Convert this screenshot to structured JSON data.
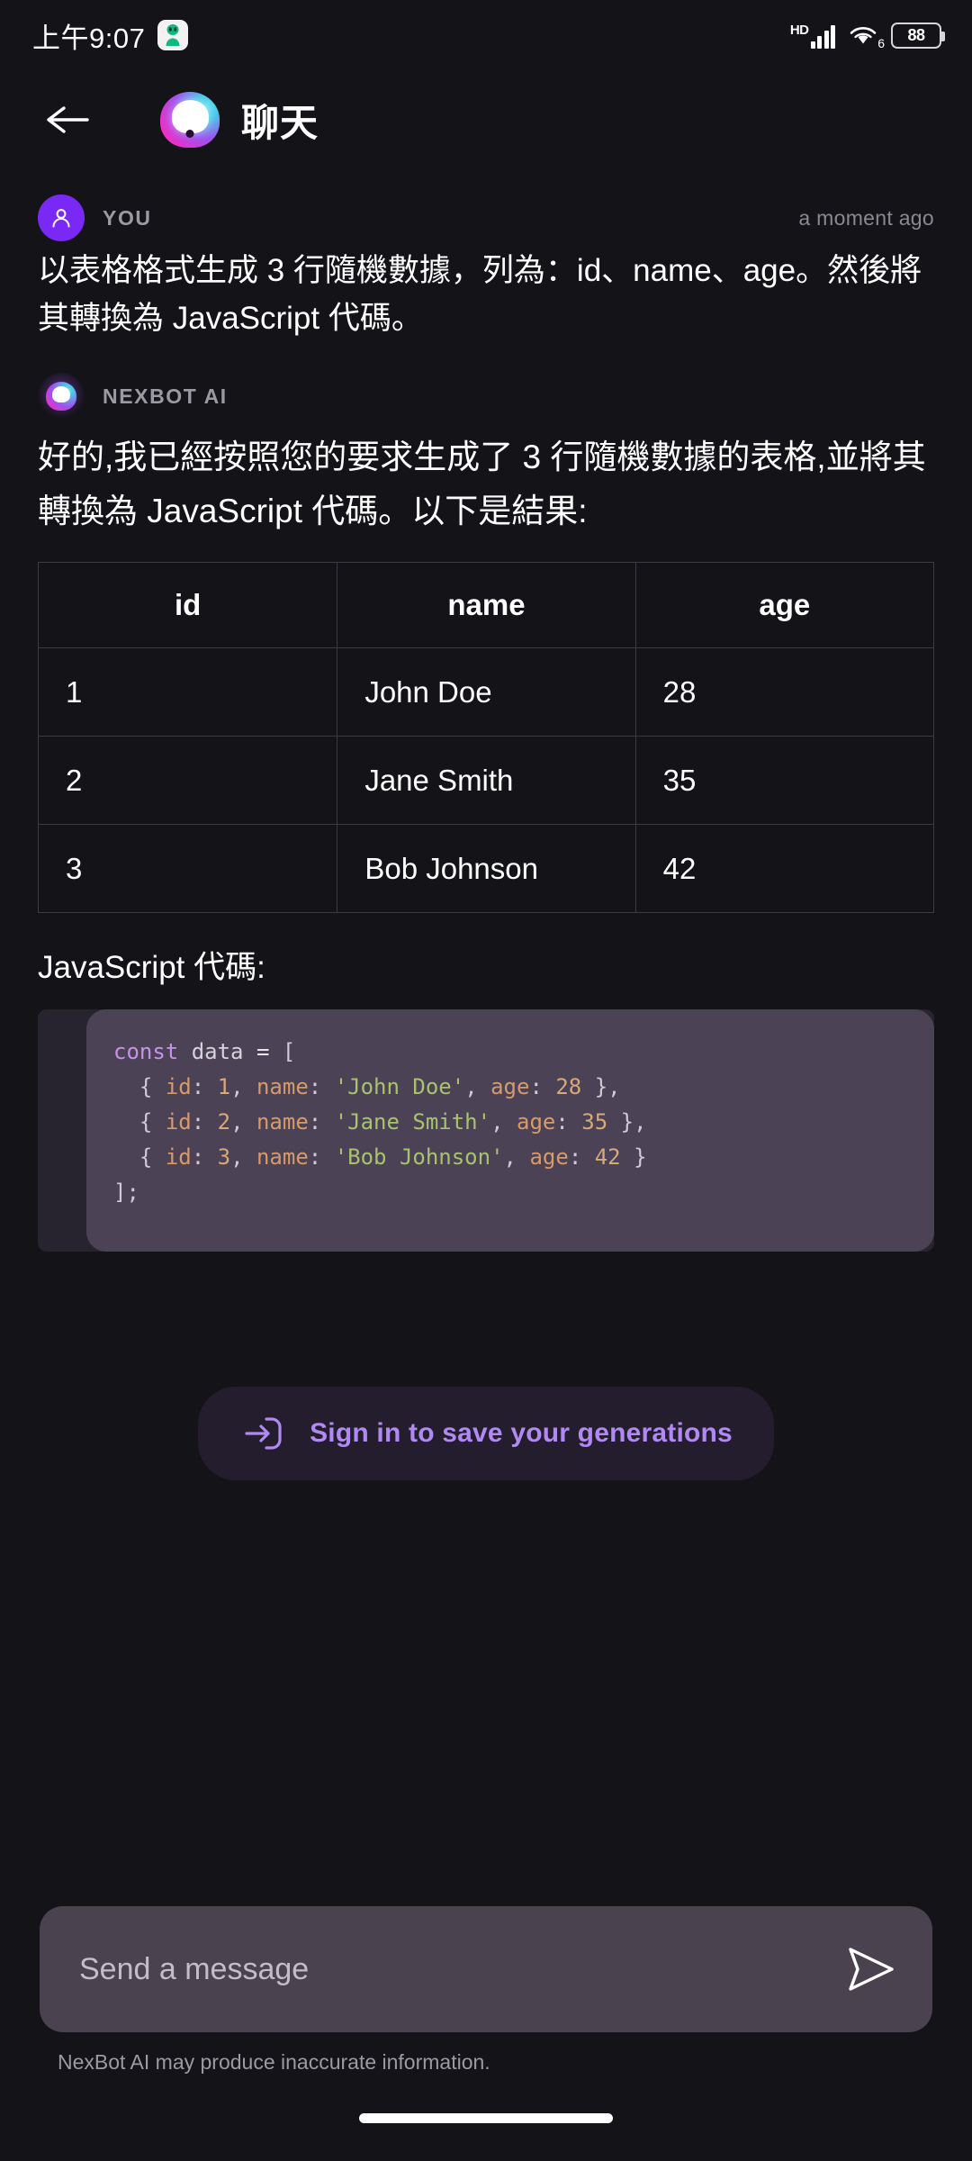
{
  "status_bar": {
    "time": "上午9:07",
    "badge_icon": "alien-avatar-icon",
    "hd_label": "HD",
    "signal_icon": "cellular-signal-icon",
    "wifi_icon": "wifi-icon",
    "wifi_generation": "6",
    "battery_level": "88"
  },
  "header": {
    "back_icon": "back-arrow-icon",
    "logo_icon": "nexbot-logo-icon",
    "title": "聊天"
  },
  "conversation": [
    {
      "sender": "YOU",
      "timestamp": "a moment ago",
      "avatar_icon": "user-avatar-icon",
      "text": "以表格格式生成 3 行隨機數據，列為：id、name、age。然後將其轉換為 JavaScript 代碼。"
    },
    {
      "sender": "NEXBOT AI",
      "timestamp": "",
      "avatar_icon": "nexbot-avatar-icon",
      "text": "好的,我已經按照您的要求生成了 3 行隨機數據的表格,並將其轉換為 JavaScript 代碼。以下是結果:"
    }
  ],
  "table": {
    "headers": [
      "id",
      "name",
      "age"
    ],
    "rows": [
      [
        "1",
        "John Doe",
        "28"
      ],
      [
        "2",
        "Jane Smith",
        "35"
      ],
      [
        "3",
        "Bob Johnson",
        "42"
      ]
    ]
  },
  "code_block": {
    "label": "JavaScript 代碼:",
    "language": "javascript",
    "lines": [
      "const data = [",
      "  { id: 1, name: 'John Doe', age: 28 },",
      "  { id: 2, name: 'Jane Smith', age: 35 },",
      "  { id: 3, name: 'Bob Johnson', age: 42 }",
      "];"
    ],
    "tokens": {
      "keyword": "const",
      "variable": "data",
      "keys": [
        "id",
        "name",
        "age"
      ],
      "strings": [
        "John Doe",
        "Jane Smith",
        "Bob Johnson"
      ],
      "numbers": [
        "1",
        "28",
        "2",
        "35",
        "3",
        "42"
      ]
    }
  },
  "signin": {
    "icon": "login-arrow-icon",
    "label": "Sign in to save your generations"
  },
  "composer": {
    "placeholder": "Send a message",
    "send_icon": "send-arrow-icon",
    "disclaimer": "NexBot AI may produce inaccurate information."
  },
  "colors": {
    "background": "#141318",
    "accent_purple": "#7a28f5",
    "signin_text": "#b189f2",
    "code_panel": "#4b4256",
    "composer": "#4b4250",
    "code_keyword": "#c792ea",
    "code_key": "#d79a6a",
    "code_string": "#a8c36b",
    "code_number": "#d8a878"
  }
}
